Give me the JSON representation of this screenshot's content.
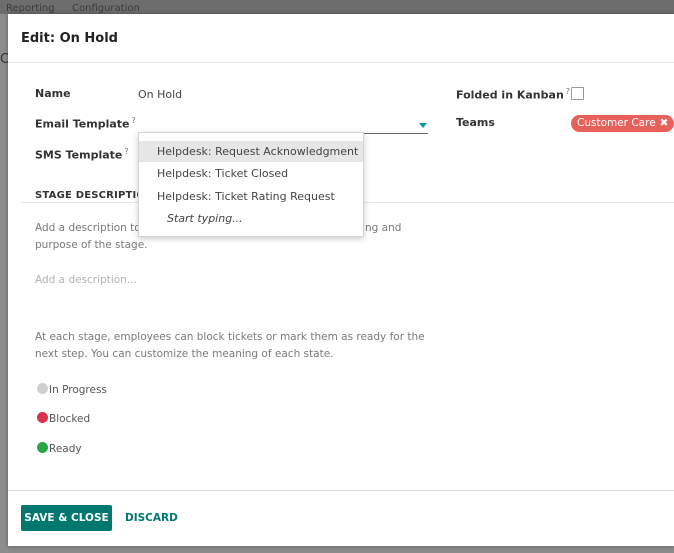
{
  "background": {
    "menu": [
      "Reporting",
      "Configuration"
    ],
    "left_char": "C"
  },
  "modal": {
    "title": "Edit: On Hold"
  },
  "form": {
    "name_label": "Name",
    "name_value": "On Hold",
    "email_template_label": "Email Template",
    "email_template_value": "",
    "sms_template_label": "SMS Template",
    "folded_label": "Folded in Kanban",
    "folded_checked": false,
    "teams_label": "Teams",
    "teams_tags": [
      "Customer Care"
    ],
    "help_mark": "?"
  },
  "dropdown": {
    "options": [
      "Helpdesk: Request Acknowledgment",
      "Helpdesk: Ticket Closed",
      "Helpdesk: Ticket Rating Request"
    ],
    "highlighted_index": 0,
    "start_typing": "Start typing..."
  },
  "stage_description": {
    "title_visible": "STAGE DESCRIPTION A",
    "intro_line1_left": "Add a description to",
    "intro_line1_right": "ng and",
    "intro_line2": "purpose of the stage.",
    "placeholder": "Add a description...",
    "states_line1": "At each stage, employees can block tickets or mark them as ready for the",
    "states_line2": "next step. You can customize the meaning of each state."
  },
  "states": [
    {
      "label": "In Progress",
      "color": "#cfcfcf"
    },
    {
      "label": "Blocked",
      "color": "#d9334d"
    },
    {
      "label": "Ready",
      "color": "#28a745"
    }
  ],
  "footer": {
    "save_label": "SAVE & CLOSE",
    "discard_label": "DISCARD"
  },
  "colors": {
    "primary": "#00786f",
    "tag": "#e8605a",
    "caret": "#00a09d"
  }
}
